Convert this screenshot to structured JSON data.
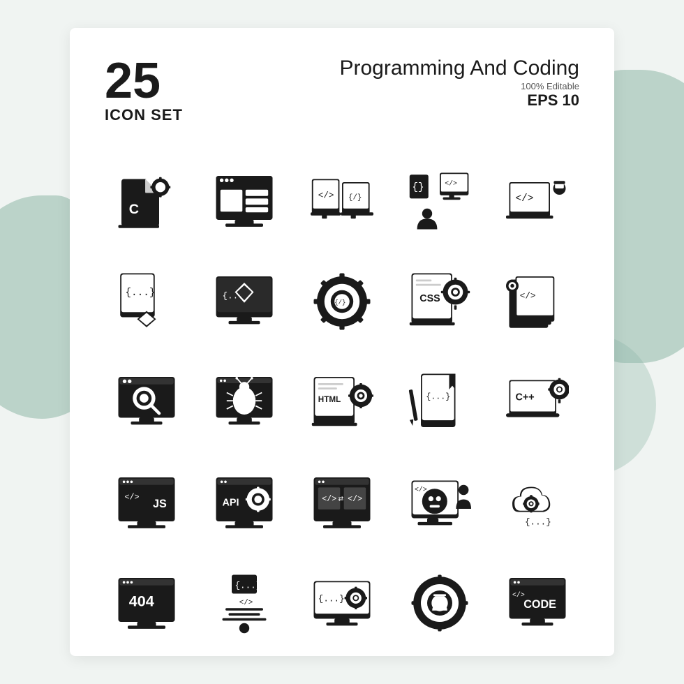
{
  "header": {
    "number": "25",
    "iconset_label": "ICON SET",
    "title": "Programming And Coding",
    "editable": "100% Editable",
    "eps": "EPS 10"
  },
  "icons": [
    {
      "id": 1,
      "name": "c-programming",
      "row": 1,
      "col": 1
    },
    {
      "id": 2,
      "name": "web-layout",
      "row": 1,
      "col": 2
    },
    {
      "id": 3,
      "name": "code-monitor",
      "row": 1,
      "col": 3
    },
    {
      "id": 4,
      "name": "online-coding",
      "row": 1,
      "col": 4
    },
    {
      "id": 5,
      "name": "code-consultant",
      "row": 1,
      "col": 5
    },
    {
      "id": 6,
      "name": "code-file-diamond",
      "row": 2,
      "col": 1
    },
    {
      "id": 7,
      "name": "diamond-monitor",
      "row": 2,
      "col": 2
    },
    {
      "id": 8,
      "name": "code-gear",
      "row": 2,
      "col": 3
    },
    {
      "id": 9,
      "name": "css-settings",
      "row": 2,
      "col": 4
    },
    {
      "id": 10,
      "name": "code-layers-gear",
      "row": 2,
      "col": 5
    },
    {
      "id": 11,
      "name": "search-monitor",
      "row": 3,
      "col": 1
    },
    {
      "id": 12,
      "name": "bug-monitor",
      "row": 3,
      "col": 2
    },
    {
      "id": 13,
      "name": "html-settings",
      "row": 3,
      "col": 3
    },
    {
      "id": 14,
      "name": "html-bookmark",
      "row": 3,
      "col": 4
    },
    {
      "id": 15,
      "name": "cpp-laptop",
      "row": 3,
      "col": 5
    },
    {
      "id": 16,
      "name": "js-browser",
      "row": 4,
      "col": 1
    },
    {
      "id": 17,
      "name": "api-settings",
      "row": 4,
      "col": 2
    },
    {
      "id": 18,
      "name": "code-browser",
      "row": 4,
      "col": 3
    },
    {
      "id": 19,
      "name": "robot-monitor",
      "row": 4,
      "col": 4
    },
    {
      "id": 20,
      "name": "cloud-settings",
      "row": 4,
      "col": 5
    },
    {
      "id": 21,
      "name": "404-browser",
      "row": 5,
      "col": 1
    },
    {
      "id": 22,
      "name": "developer-code",
      "row": 5,
      "col": 2
    },
    {
      "id": 23,
      "name": "code-gear-monitor",
      "row": 5,
      "col": 3
    },
    {
      "id": 24,
      "name": "gear-person",
      "row": 5,
      "col": 4
    },
    {
      "id": 25,
      "name": "code-monitor-label",
      "row": 5,
      "col": 5
    }
  ]
}
